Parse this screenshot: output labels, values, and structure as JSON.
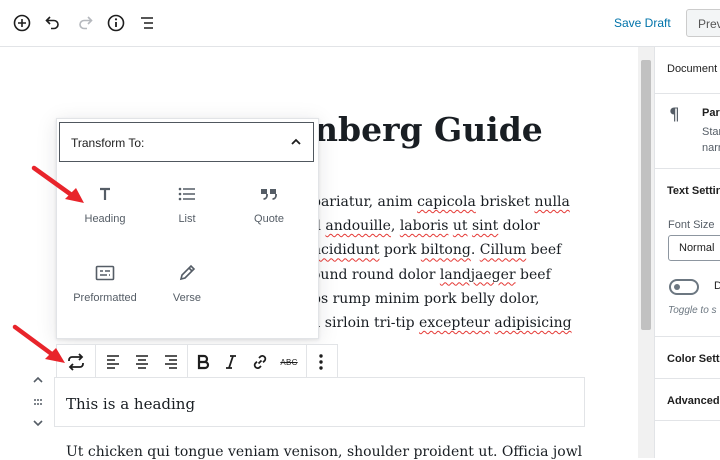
{
  "header": {
    "save_draft": "Save Draft",
    "preview": "Preview",
    "icons": [
      "add-block-icon",
      "undo-icon",
      "redo-icon",
      "info-icon",
      "outline-icon"
    ]
  },
  "sidebar": {
    "tab": "Document",
    "block_name": "Para",
    "block_desc_1": "Star",
    "block_desc_2": "narr",
    "text_settings": "Text Setting",
    "font_size_label": "Font Size",
    "font_size_value": "Normal",
    "drop_cap_label": "D",
    "toggle_hint": "Toggle to s",
    "color_settings": "Color Setti",
    "advanced": "Advanced"
  },
  "post": {
    "title_visible": "nberg Guide",
    "paragraph_lines": [
      [
        {
          "t": "pariatur, anim "
        },
        {
          "t": "capicola",
          "sq": true
        },
        {
          "t": " brisket "
        },
        {
          "t": "nulla",
          "sq": true
        }
      ],
      [
        {
          "t": "d "
        },
        {
          "t": "andouille",
          "sq": true
        },
        {
          "t": ", "
        },
        {
          "t": "laboris",
          "sq": true
        },
        {
          "t": " "
        },
        {
          "t": "ut",
          "sq": true
        },
        {
          "t": " "
        },
        {
          "t": "sint",
          "sq": true
        },
        {
          "t": " dolor"
        }
      ],
      [
        {
          "t": "ncididunt",
          "sq": true
        },
        {
          "t": " pork "
        },
        {
          "t": "biltong",
          "sq": true
        },
        {
          "t": ". "
        },
        {
          "t": "Cillum",
          "sq": true
        },
        {
          "t": " beef"
        }
      ],
      [
        {
          "t": "ound round dolor "
        },
        {
          "t": "landjaeger",
          "sq": true
        },
        {
          "t": " beef"
        }
      ],
      [
        {
          "t": "bs rump minim pork belly dolor,"
        }
      ],
      [
        {
          "t": "a sirloin tri-tip "
        },
        {
          "t": "excepteur",
          "sq": true
        },
        {
          "t": " "
        },
        {
          "t": "adipisicing",
          "sq": true
        }
      ]
    ],
    "heading_block_text": "This is a heading",
    "next_paragraph": "Ut chicken qui tongue veniam venison, shoulder proident ut. Officia jowl"
  },
  "transform": {
    "header": "Transform To:",
    "items": [
      {
        "label": "Heading",
        "icon": "heading-icon"
      },
      {
        "label": "List",
        "icon": "list-icon"
      },
      {
        "label": "Quote",
        "icon": "quote-icon"
      },
      {
        "label": "Preformatted",
        "icon": "preformatted-icon"
      },
      {
        "label": "Verse",
        "icon": "verse-icon"
      }
    ]
  },
  "block_toolbar": {
    "buttons": [
      "transform-icon",
      "align-left-icon",
      "align-center-icon",
      "align-right-icon",
      "bold-icon",
      "italic-icon",
      "link-icon",
      "strikethrough-icon",
      "more-options-icon"
    ],
    "strikethrough_glyph": "ABC"
  },
  "colors": {
    "accent": "#0073aa",
    "arrow": "#e8242b",
    "spellcheck": "#e53935"
  }
}
